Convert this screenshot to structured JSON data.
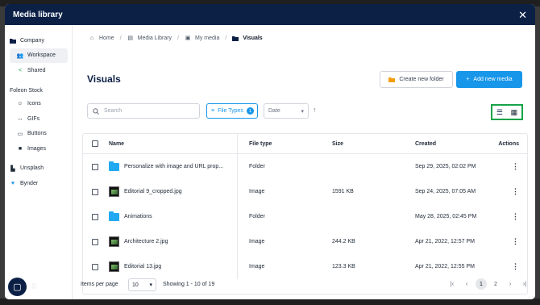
{
  "modal": {
    "title": "Media library",
    "close_icon": "close-icon"
  },
  "sidebar": {
    "company": "Company",
    "workspace": "Workspace",
    "shared": "Shared",
    "foleon_stock": "Foleon Stock",
    "icons": "Icons",
    "gifs": "GIFs",
    "buttons": "Buttons",
    "images": "Images",
    "unsplash": "Unsplash",
    "bynder": "Bynder"
  },
  "breadcrumb": [
    "Home",
    "Media Library",
    "My media",
    "Visuals"
  ],
  "page": {
    "title": "Visuals",
    "create_folder": "Create new folder",
    "add_media": "Add new media"
  },
  "toolbar": {
    "search_placeholder": "Search",
    "file_types_label": "File Types",
    "file_types_count": "1",
    "sort_select": "Date"
  },
  "table": {
    "headers": {
      "name": "Name",
      "type": "File type",
      "size": "Size",
      "created": "Created",
      "actions": "Actions"
    },
    "rows": [
      {
        "name": "Personalize with image and URL prop...",
        "type": "Folder",
        "size": "",
        "created": "Sep 29, 2025, 02:02 PM",
        "thumb": "folder"
      },
      {
        "name": "Editorial 9_cropped.jpg",
        "type": "Image",
        "size": "1591 KB",
        "created": "Sep 24, 2025, 07:05 AM",
        "thumb": "image"
      },
      {
        "name": "Animations",
        "type": "Folder",
        "size": "",
        "created": "May 28, 2025, 02:45 PM",
        "thumb": "folder"
      },
      {
        "name": "Architecture 2.jpg",
        "type": "Image",
        "size": "244.2 KB",
        "created": "Apr 21, 2022, 12:57 PM",
        "thumb": "image"
      },
      {
        "name": "Editorial 13.jpg",
        "type": "Image",
        "size": "123.3 KB",
        "created": "Apr 21, 2022, 12:55 PM",
        "thumb": "image"
      }
    ]
  },
  "footer": {
    "items_per_page_label": "Items per page",
    "items_per_page": "10",
    "showing": "Showing 1 - 10 of 19",
    "pages": [
      "1",
      "2"
    ],
    "current_page": "1"
  },
  "colors": {
    "header_bg": "#0c2046",
    "accent": "#1796ea",
    "folder": "#21a9f1",
    "highlight": "#16a34a"
  }
}
